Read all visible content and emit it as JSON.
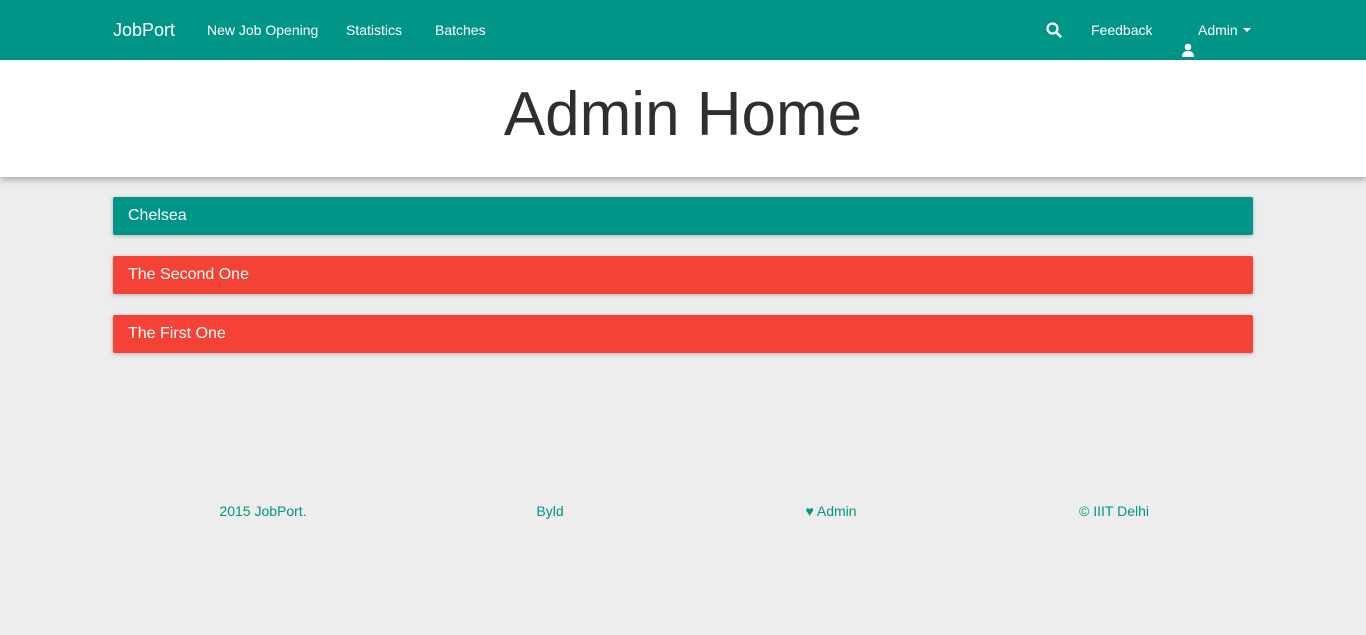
{
  "navbar": {
    "brand": "JobPort",
    "links": [
      "New Job Opening",
      "Statistics",
      "Batches"
    ],
    "search_icon": "search-icon",
    "feedback": "Feedback",
    "user_icon": "user-icon",
    "admin": "Admin"
  },
  "header": {
    "title": "Admin Home"
  },
  "batches": [
    {
      "name": "Chelsea",
      "color": "#009587"
    },
    {
      "name": "The Second One",
      "color": "#f44336"
    },
    {
      "name": "The First One",
      "color": "#f44336"
    }
  ],
  "footer": {
    "items": [
      "2015 JobPort.",
      "Byld",
      "♥ Admin",
      "© IIIT Delhi"
    ]
  },
  "colors": {
    "primary": "#009587",
    "danger": "#f44336",
    "background": "#ededed"
  }
}
